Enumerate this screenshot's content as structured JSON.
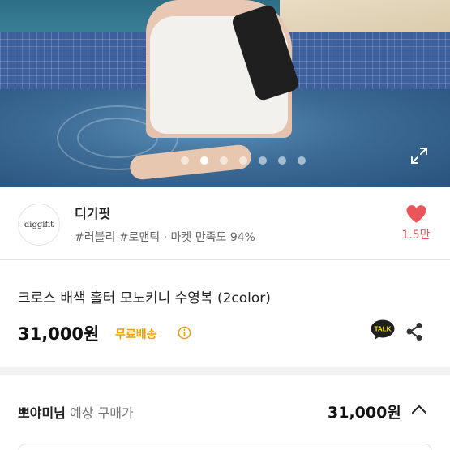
{
  "gallery": {
    "slide_count": 7,
    "active_index": 1
  },
  "seller": {
    "logo_text": "diggifit",
    "name": "디기핏",
    "tags": "#러블리 #로맨틱 · 마켓 만족도 94%",
    "likes": "1.5만",
    "heart_color": "#e8565b"
  },
  "product": {
    "title": "크로스 배색 홀터 모노키니 수영복 (2color)",
    "price": "31,000원",
    "shipping": "무료배송",
    "talk_label": "TALK"
  },
  "expected_price": {
    "user": "뽀야미님",
    "label": "예상 구매가",
    "price": "31,000원"
  },
  "icons": {
    "expand": "expand-icon",
    "info": "info-icon",
    "talk": "kakaotalk-icon",
    "share": "share-icon",
    "chevron": "chevron-up-icon",
    "heart": "heart-icon"
  },
  "colors": {
    "accent_red": "#e8565b",
    "shipping_orange": "#f0a000"
  }
}
